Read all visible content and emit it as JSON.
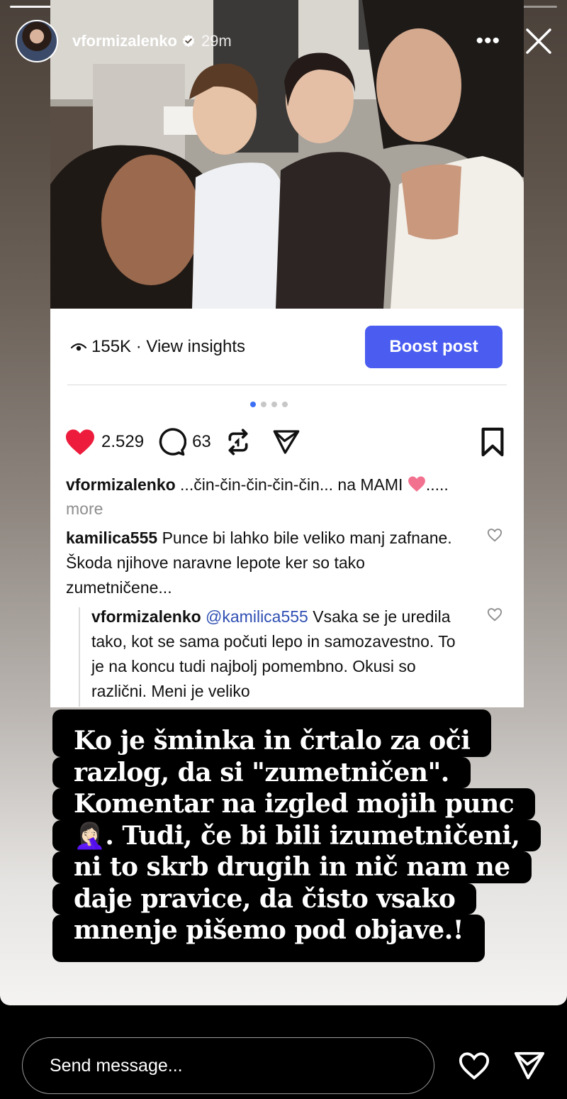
{
  "story": {
    "username": "vformizalenko",
    "time": "29m",
    "progress_segments": 8,
    "progress_done": 7
  },
  "post": {
    "views": "155K · View insights",
    "boost_label": "Boost post",
    "carousel_dots": 4,
    "likes": "2.529",
    "comments_count": "63",
    "caption_user": "vformizalenko",
    "caption_text": "...čin-čin-čin-čin-čin... na MAMI",
    "caption_tail": ".....",
    "caption_more": "more",
    "comment1_user": "kamilica555",
    "comment1_text": "Punce bi lahko bile veliko manj zafnane. Škoda njihove naravne lepote ker so tako zumetničene...",
    "reply_user": "vformizalenko",
    "reply_mention": "@kamilica555",
    "reply_text": "Vsaka se je uredila tako, kot se sama počuti lepo in samozavestno. To je na koncu tudi najbolj pomembno. Okusi so različni. Meni je veliko"
  },
  "overlay": {
    "lines": [
      "Ko je šminka in črtalo za oči",
      "razlog, da si \"zumetničen\".",
      "Komentar na izgled mojih punc",
      "🤦🏻‍♀️. Tudi, če bi bili izumetničeni,",
      "ni to skrb drugih in nič  nam ne",
      "daje pravice, da čisto vsako",
      "mnenje pišemo pod objave.!"
    ]
  },
  "bottom_bar": {
    "message_placeholder": "Send message..."
  },
  "colors": {
    "boost": "#4a5df0",
    "like_red": "#ed1c3c",
    "mention": "#2f4fb3",
    "dot_active": "#3b6ff5"
  }
}
